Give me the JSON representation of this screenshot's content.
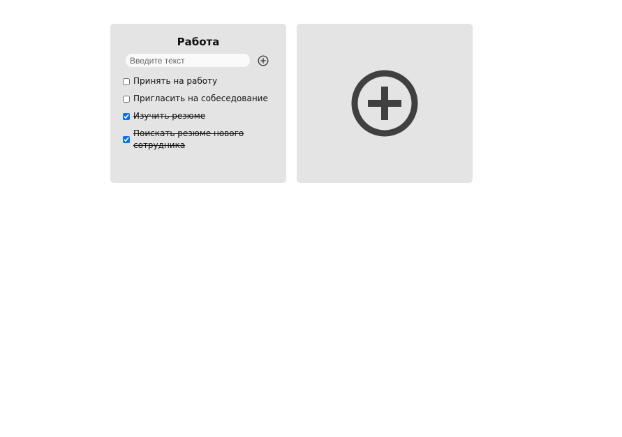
{
  "board": {
    "lists": [
      {
        "title": "Работа",
        "input_placeholder": "Введите текст",
        "tasks": [
          {
            "label": "Принять на работу",
            "done": false
          },
          {
            "label": "Пригласить на собеседование",
            "done": false
          },
          {
            "label": "Изучить резюме",
            "done": true
          },
          {
            "label": "Поискать резюме нового сотрудника",
            "done": true
          }
        ]
      }
    ],
    "icons": {
      "add_task": "plus-circle-icon",
      "add_list": "plus-circle-icon"
    },
    "colors": {
      "card_bg": "#e4e4e4",
      "icon": "#404040",
      "checkbox_checked": "#1a73e8"
    }
  }
}
